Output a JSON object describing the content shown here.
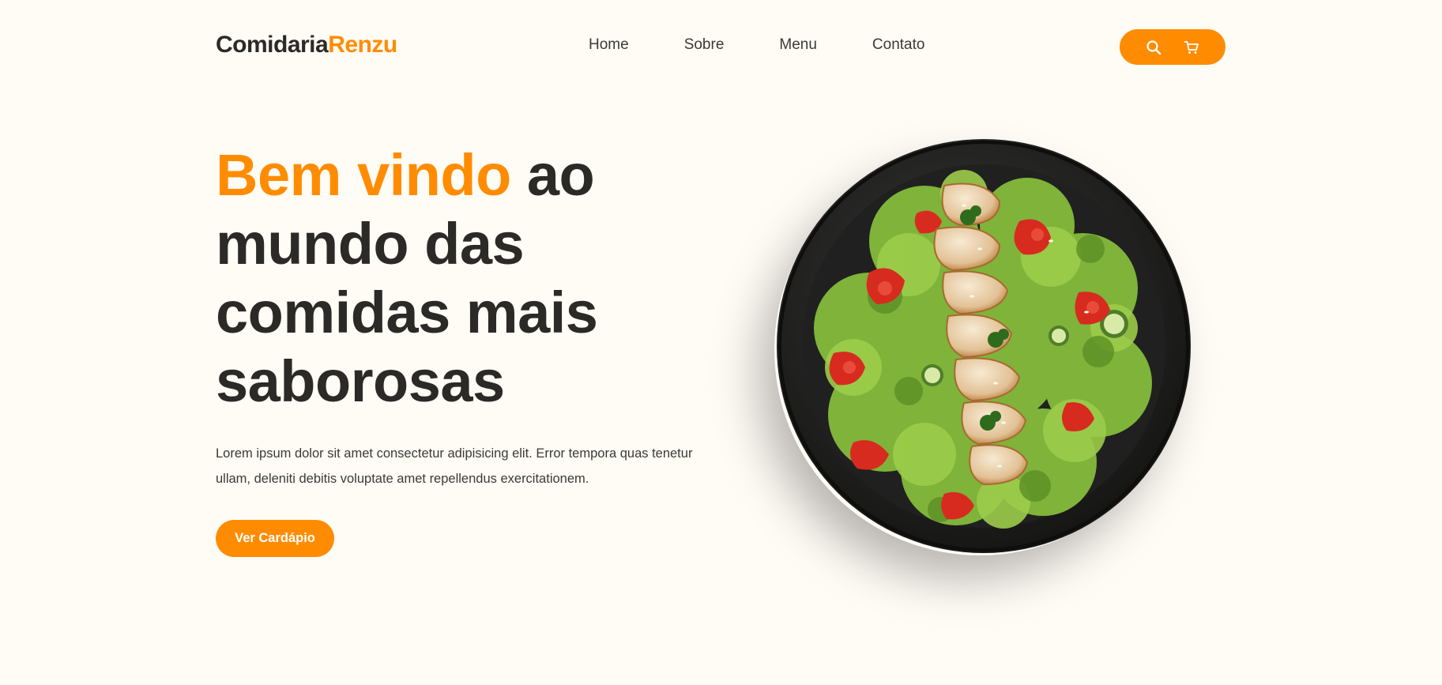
{
  "brand": {
    "part1": "Comidaria",
    "part2": "Renzu",
    "accent_color": "#ff8c00"
  },
  "nav": {
    "items": [
      {
        "label": "Home"
      },
      {
        "label": "Sobre"
      },
      {
        "label": "Menu"
      },
      {
        "label": "Contato"
      }
    ]
  },
  "actions": {
    "icons": [
      "search-icon",
      "cart-icon"
    ]
  },
  "hero": {
    "title_highlight": "Bem vindo",
    "title_rest": " ao mundo das comidas mais saborosas",
    "description": "Lorem ipsum dolor sit amet consectetur adipisicing elit. Error tempora quas tenetur ullam, deleniti debitis voluptate amet repellendus exercitationem.",
    "cta_label": "Ver Cardápio"
  },
  "image": {
    "subject": "salad-plate"
  }
}
